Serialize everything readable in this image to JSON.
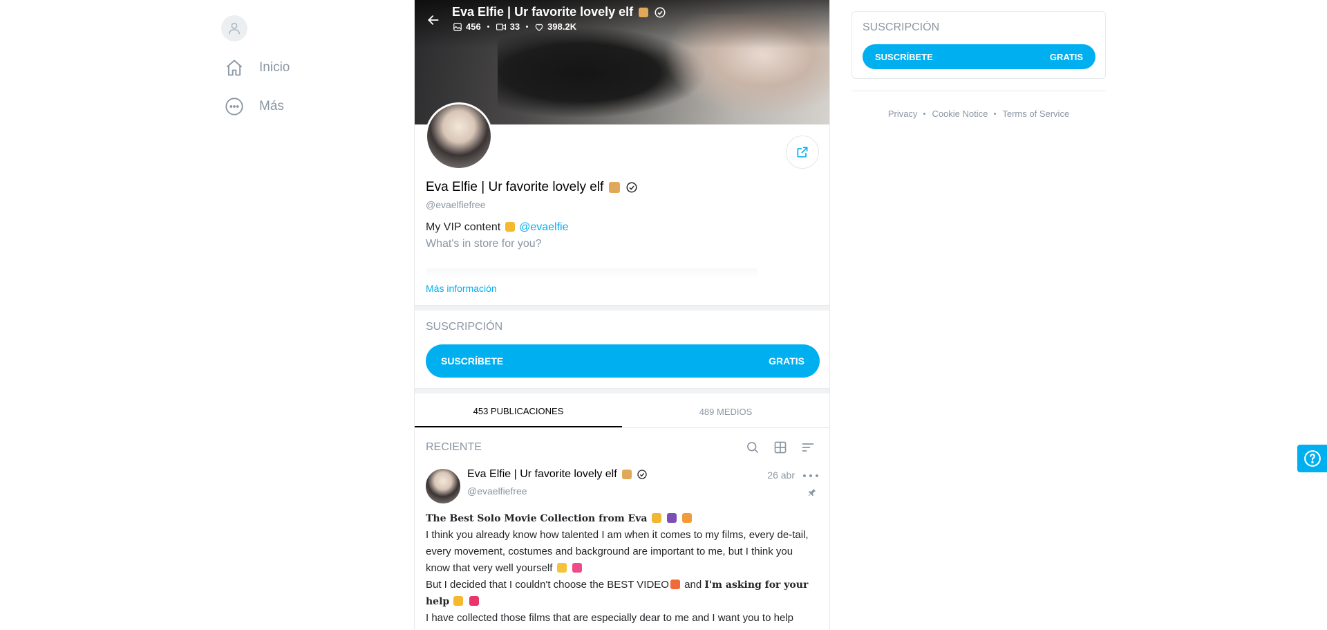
{
  "nav": {
    "items": [
      {
        "label": "Inicio",
        "icon": "home-icon"
      },
      {
        "label": "Más",
        "icon": "more-circle-icon"
      }
    ]
  },
  "profile": {
    "header_name": "Eva Elfie | Ur favorite lovely elf",
    "stats": {
      "photos": "456",
      "videos": "33",
      "likes": "398.2K"
    },
    "name": "Eva Elfie | Ur favorite lovely elf",
    "handle": "@evaelfiefree",
    "bio_line1_prefix": "My VIP content",
    "bio_link": "@evaelfie",
    "bio_line2": "What's in store for you?",
    "more_info": "Más información"
  },
  "subscription": {
    "label": "SUSCRIPCIÓN",
    "button_label": "SUSCRÍBETE",
    "price": "GRATIS"
  },
  "tabs": [
    {
      "label": "453 PUBLICACIONES",
      "active": true
    },
    {
      "label": "489 MEDIOS",
      "active": false
    }
  ],
  "feed": {
    "section_label": "RECIENTE"
  },
  "post": {
    "author_name": "Eva Elfie | Ur favorite lovely elf",
    "author_handle": "@evaelfiefree",
    "date": "26 abr",
    "title": "The Best Solo Movie Collection from Eva",
    "para1": "I think you already know how talented I am when it comes to my films, every de-tail, every movement, costumes and background are important to me, but I think you know that very well yourself",
    "para2_start": "But I decided that I couldn't choose the BEST VIDEO",
    "para2_mid": " and ",
    "para2_bold": "I'm asking for your help",
    "para3": "I have collected those films that are especially dear to me and I want you to help"
  },
  "sidebar_right": {
    "label": "SUSCRIPCIÓN",
    "button_label": "SUSCRÍBETE",
    "price": "GRATIS",
    "footer": [
      "Privacy",
      "Cookie Notice",
      "Terms of Service"
    ]
  },
  "colors": {
    "accent": "#00aff0",
    "muted": "#8a96a3"
  }
}
